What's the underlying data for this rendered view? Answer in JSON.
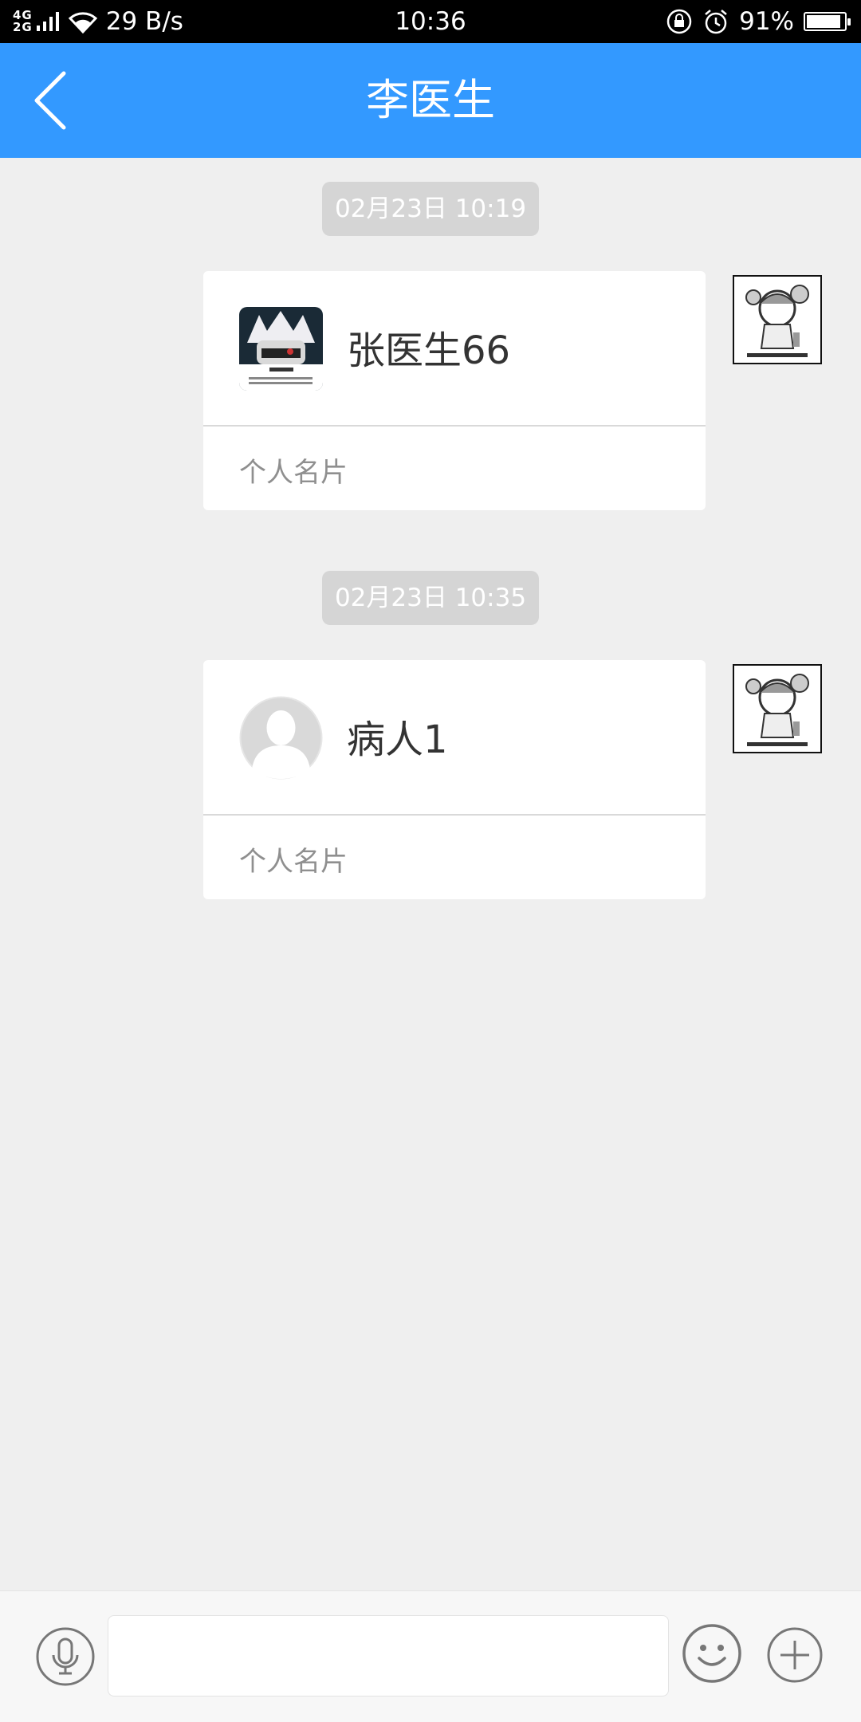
{
  "status_bar": {
    "network": "4G\n2G",
    "speed": "29 B/s",
    "time": "10:36",
    "battery": "91%",
    "battery_level": 0.91
  },
  "header": {
    "title": "李医生",
    "back_icon": "chevron-left-icon"
  },
  "messages": [
    {
      "time": "02月23日 10:19",
      "card_name": "张医生66",
      "card_label": "个人名片"
    },
    {
      "time": "02月23日 10:35",
      "card_name": "病人1",
      "card_label": "个人名片"
    }
  ],
  "input_bar": {
    "placeholder": "",
    "voice_icon": "microphone-icon",
    "emoji_icon": "emoji-icon",
    "plus_icon": "plus-icon"
  },
  "colors": {
    "accent": "#3399ff",
    "background": "#efefef",
    "chip": "#d5d5d5"
  }
}
